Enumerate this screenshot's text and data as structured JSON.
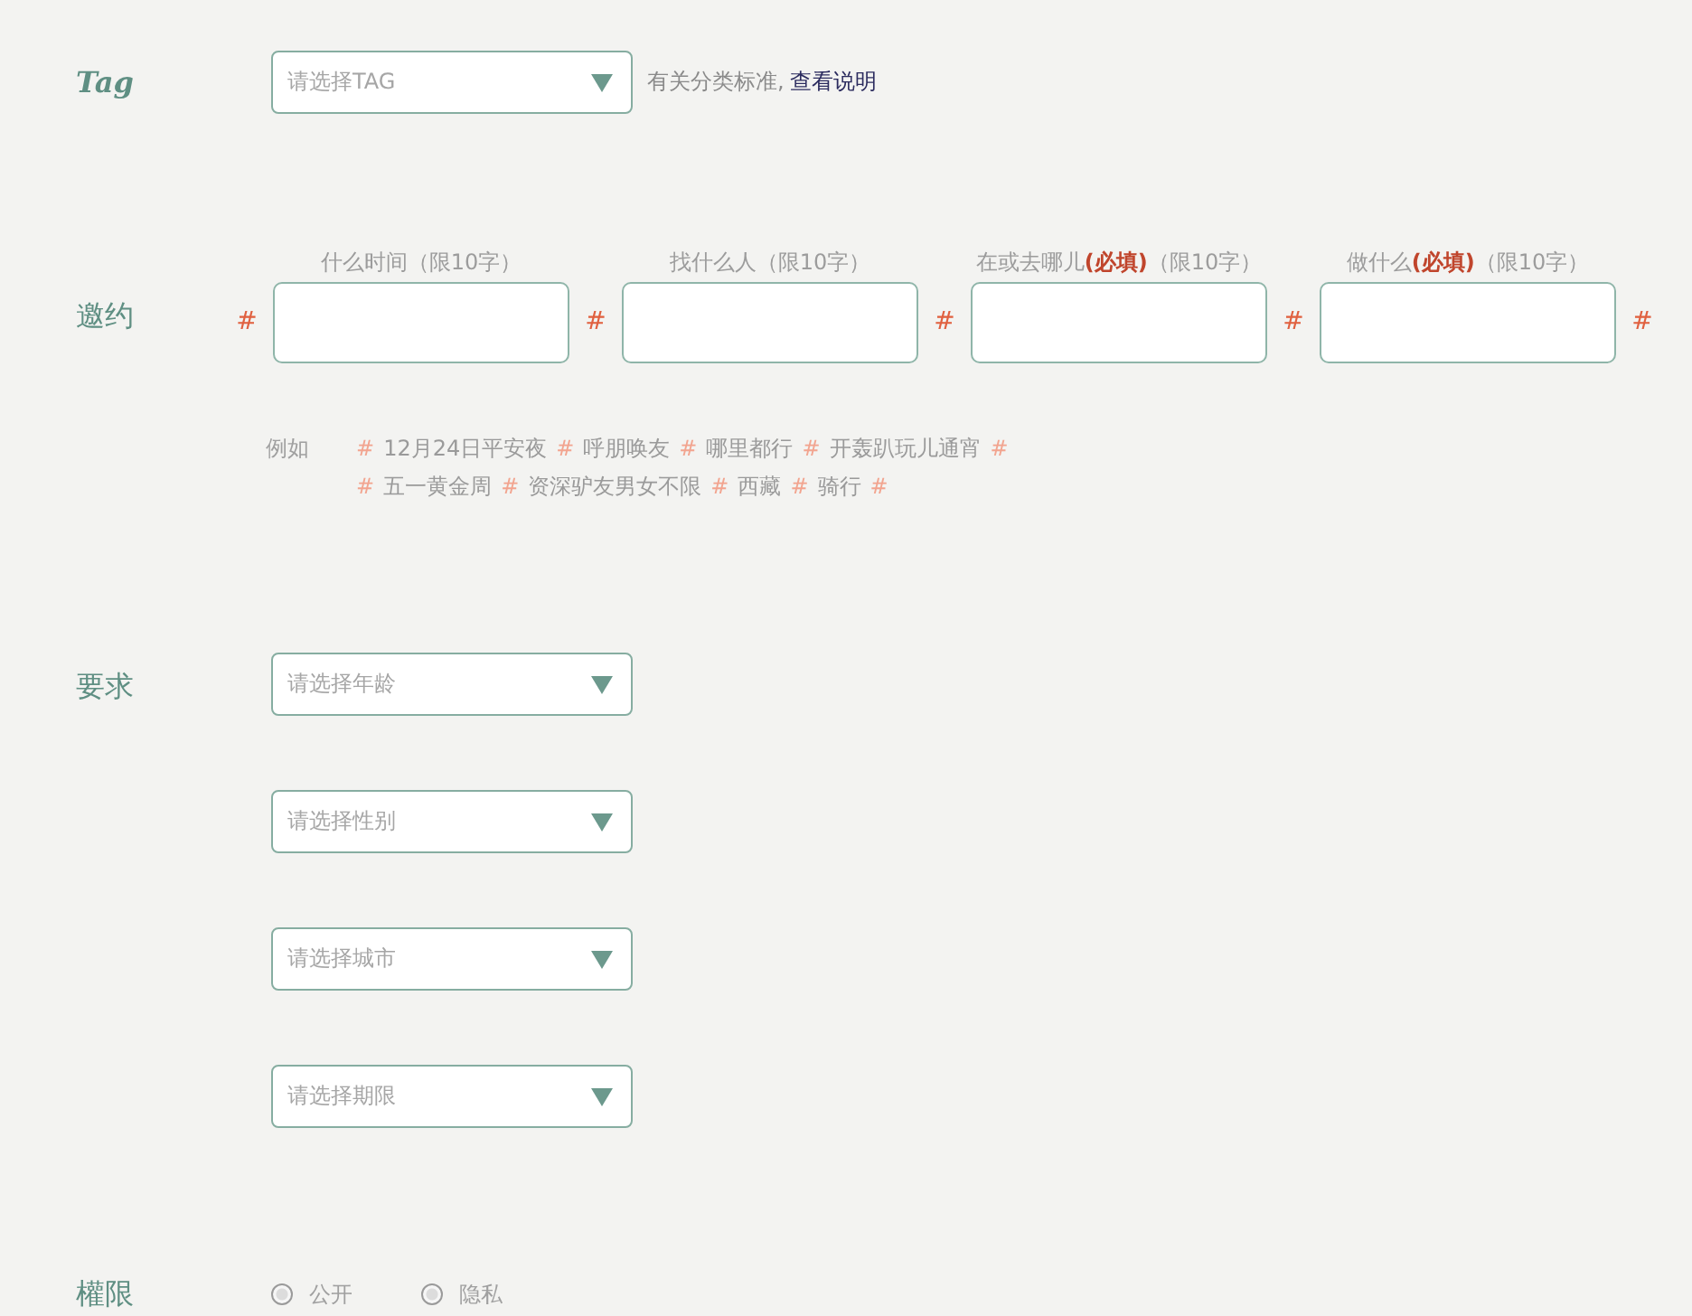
{
  "tag": {
    "label": "Tag",
    "select": {
      "placeholder": "请选择TAG"
    },
    "hint": "有关分类标准,",
    "link": "查看说明"
  },
  "invite": {
    "label": "邀约",
    "fields": [
      {
        "hash": "#",
        "caption": "什么时间（限10字）"
      },
      {
        "hash": "#",
        "caption": "找什么人（限10字）"
      },
      {
        "hash": "#",
        "caption": "在或去哪儿**(必填)**（限10字）"
      },
      {
        "hash": "#",
        "caption": "做什么**(必填)**（限10字）"
      }
    ],
    "end_hash": "#"
  },
  "example": {
    "label": "例如",
    "lines": [
      {
        "items": [
          {
            "kind": "hash",
            "text": "#"
          },
          {
            "kind": "tag",
            "text": "12月24日平安夜"
          },
          {
            "kind": "hash",
            "text": "#"
          },
          {
            "kind": "tag",
            "text": "呼朋唤友"
          },
          {
            "kind": "hash",
            "text": "#"
          },
          {
            "kind": "tag",
            "text": "哪里都行"
          },
          {
            "kind": "hash",
            "text": "#"
          },
          {
            "kind": "tag",
            "text": "开轰趴玩儿通宵"
          },
          {
            "kind": "hash",
            "text": "#"
          }
        ]
      },
      {
        "items": [
          {
            "kind": "hash",
            "text": "#"
          },
          {
            "kind": "tag",
            "text": "五一黄金周"
          },
          {
            "kind": "hash",
            "text": "#"
          },
          {
            "kind": "tag",
            "text": "资深驴友男女不限"
          },
          {
            "kind": "hash",
            "text": "#"
          },
          {
            "kind": "tag",
            "text": "西藏"
          },
          {
            "kind": "hash",
            "text": "#"
          },
          {
            "kind": "tag",
            "text": "骑行"
          },
          {
            "kind": "hash",
            "text": "#"
          }
        ]
      }
    ]
  },
  "requirements": {
    "label": "要求",
    "selects": [
      {
        "placeholder": "请选择年龄"
      },
      {
        "placeholder": "请选择性别"
      },
      {
        "placeholder": "请选择城市"
      },
      {
        "placeholder": "请选择期限"
      }
    ]
  },
  "permission": {
    "label": "權限",
    "options": [
      {
        "label": "公开",
        "selected": false
      },
      {
        "label": "隐私",
        "selected": false
      }
    ]
  }
}
